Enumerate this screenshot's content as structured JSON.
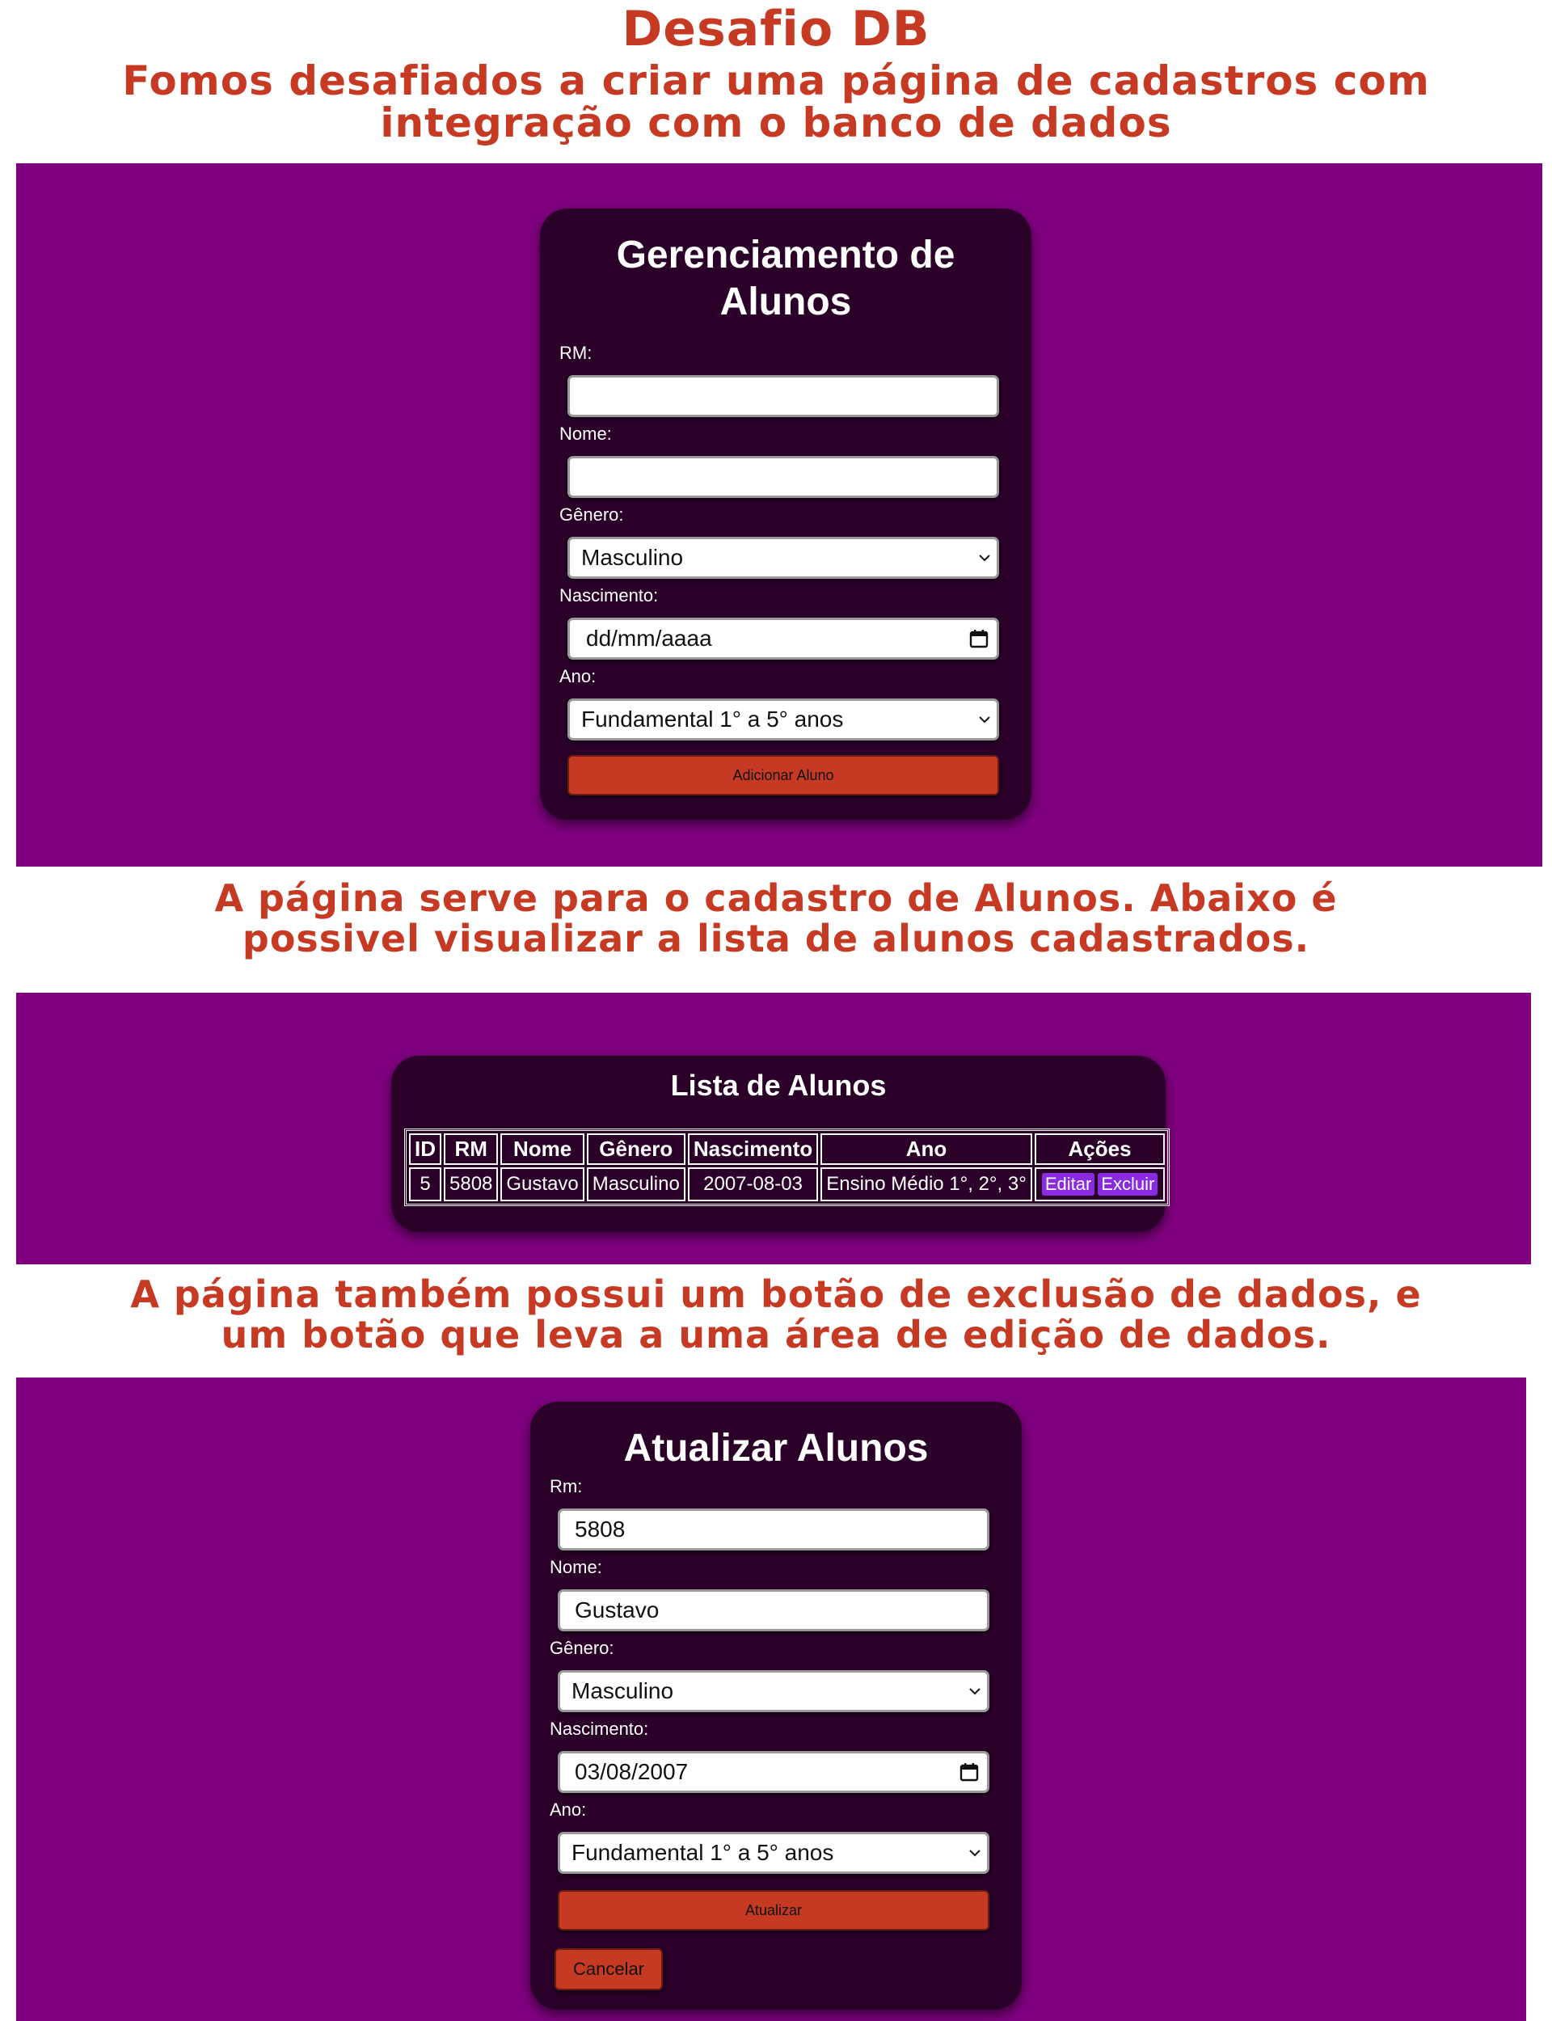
{
  "header": {
    "title": "Desafio DB",
    "subtitle_line1": "Fomos desafiados a criar uma página de cadastros com",
    "subtitle_line2": "integração com o banco de dados"
  },
  "cadastro": {
    "title_line1": "Gerenciamento de",
    "title_line2": "Alunos",
    "rm_label": "RM:",
    "rm_value": "",
    "nome_label": "Nome:",
    "nome_value": "",
    "genero_label": "Gênero:",
    "genero_value": "Masculino",
    "nascimento_label": "Nascimento:",
    "nascimento_placeholder": "dd/mm/aaaa",
    "ano_label": "Ano:",
    "ano_value": "Fundamental 1° a 5° anos",
    "submit_label": "Adicionar Aluno"
  },
  "caption1": {
    "line1": "A página serve para o cadastro de Alunos. Abaixo é",
    "line2": "possivel visualizar a lista de alunos cadastrados."
  },
  "lista": {
    "title": "Lista de Alunos",
    "columns": [
      "ID",
      "RM",
      "Nome",
      "Gênero",
      "Nascimento",
      "Ano",
      "Ações"
    ],
    "rows": [
      {
        "id": "5",
        "rm": "5808",
        "nome": "Gustavo",
        "genero": "Masculino",
        "nascimento": "2007-08-03",
        "ano": "Ensino Médio 1°, 2°, 3°",
        "editar_label": "Editar",
        "excluir_label": "Excluir"
      }
    ]
  },
  "caption2": {
    "line1": "A página também possui um botão de exclusão de dados, e",
    "line2": "um botão que leva a uma área de edição de dados."
  },
  "atualizar": {
    "title": "Atualizar Alunos",
    "rm_label": "Rm:",
    "rm_value": "5808",
    "nome_label": "Nome:",
    "nome_value": "Gustavo",
    "genero_label": "Gênero:",
    "genero_value": "Masculino",
    "nascimento_label": "Nascimento:",
    "nascimento_value": "03/08/2007",
    "ano_label": "Ano:",
    "ano_value": "Fundamental 1° a 5° anos",
    "submit_label": "Atualizar",
    "cancel_label": "Cancelar"
  },
  "colors": {
    "panel": "#7f007f",
    "card": "#2a0029",
    "accent_red": "#c63a24",
    "action_purple": "#8a2be2"
  }
}
